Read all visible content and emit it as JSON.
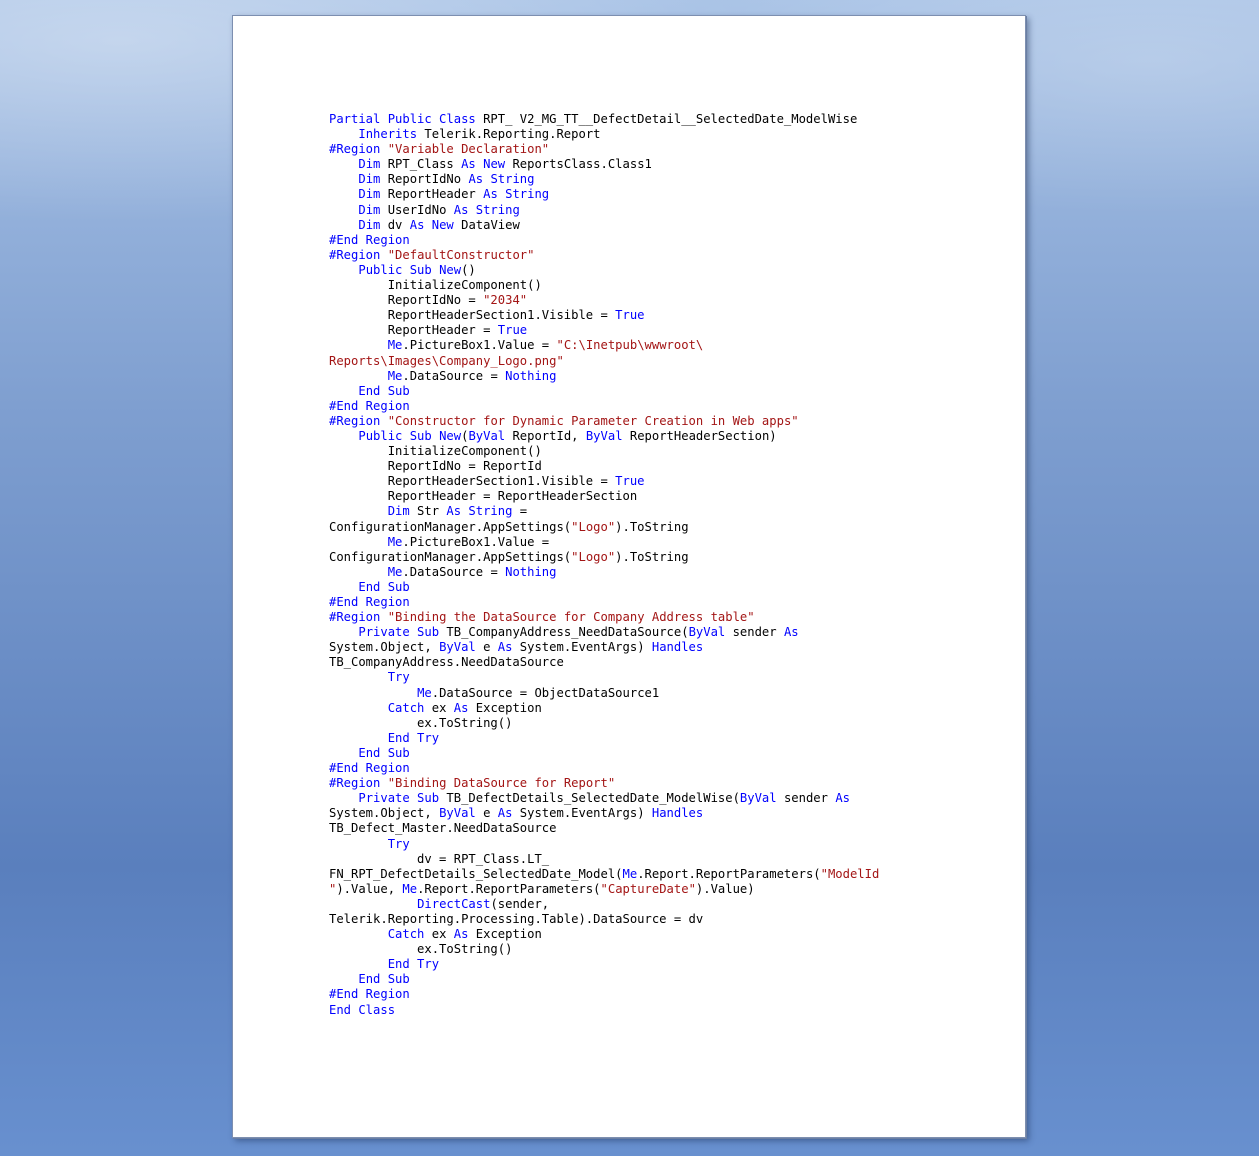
{
  "document": {
    "code_lines": [
      [
        {
          "k": "Partial Public Class"
        },
        {
          "t": " RPT_ V2_MG_TT__DefectDetail__SelectedDate_ModelWise"
        }
      ],
      [
        {
          "t": "    "
        },
        {
          "k": "Inherits"
        },
        {
          "t": " Telerik.Reporting.Report"
        }
      ],
      [
        {
          "k": "#Region"
        },
        {
          "t": " "
        },
        {
          "s": "\"Variable Declaration\""
        }
      ],
      [
        {
          "t": "    "
        },
        {
          "k": "Dim"
        },
        {
          "t": " RPT_Class "
        },
        {
          "k": "As New"
        },
        {
          "t": " ReportsClass.Class1"
        }
      ],
      [
        {
          "t": "    "
        },
        {
          "k": "Dim"
        },
        {
          "t": " ReportIdNo "
        },
        {
          "k": "As String"
        }
      ],
      [
        {
          "t": "    "
        },
        {
          "k": "Dim"
        },
        {
          "t": " ReportHeader "
        },
        {
          "k": "As String"
        }
      ],
      [
        {
          "t": "    "
        },
        {
          "k": "Dim"
        },
        {
          "t": " UserIdNo "
        },
        {
          "k": "As String"
        }
      ],
      [
        {
          "t": "    "
        },
        {
          "k": "Dim"
        },
        {
          "t": " dv "
        },
        {
          "k": "As New"
        },
        {
          "t": " DataView"
        }
      ],
      [
        {
          "k": "#End Region"
        }
      ],
      [
        {
          "k": "#Region"
        },
        {
          "t": " "
        },
        {
          "s": "\"DefaultConstructor\""
        }
      ],
      [
        {
          "t": "    "
        },
        {
          "k": "Public Sub New"
        },
        {
          "t": "()"
        }
      ],
      [
        {
          "t": "        InitializeComponent()"
        }
      ],
      [
        {
          "t": "        ReportIdNo = "
        },
        {
          "s": "\"2034\""
        }
      ],
      [
        {
          "t": "        ReportHeaderSection1.Visible = "
        },
        {
          "k": "True"
        }
      ],
      [
        {
          "t": "        ReportHeader = "
        },
        {
          "k": "True"
        }
      ],
      [
        {
          "t": "        "
        },
        {
          "k": "Me"
        },
        {
          "t": ".PictureBox1.Value = "
        },
        {
          "s": "\"C:\\Inetpub\\wwwroot\\"
        }
      ],
      [
        {
          "s": "Reports\\Images\\Company_Logo.png\""
        }
      ],
      [
        {
          "t": "        "
        },
        {
          "k": "Me"
        },
        {
          "t": ".DataSource = "
        },
        {
          "k": "Nothing"
        }
      ],
      [
        {
          "t": "    "
        },
        {
          "k": "End Sub"
        }
      ],
      [
        {
          "k": "#End Region"
        }
      ],
      [
        {
          "k": "#Region"
        },
        {
          "t": " "
        },
        {
          "s": "\"Constructor for Dynamic Parameter Creation in Web apps\""
        }
      ],
      [
        {
          "t": "    "
        },
        {
          "k": "Public Sub New"
        },
        {
          "t": "("
        },
        {
          "k": "ByVal"
        },
        {
          "t": " ReportId, "
        },
        {
          "k": "ByVal"
        },
        {
          "t": " ReportHeaderSection)"
        }
      ],
      [
        {
          "t": "        InitializeComponent()"
        }
      ],
      [
        {
          "t": "        ReportIdNo = ReportId"
        }
      ],
      [
        {
          "t": "        ReportHeaderSection1.Visible = "
        },
        {
          "k": "True"
        }
      ],
      [
        {
          "t": "        ReportHeader = ReportHeaderSection"
        }
      ],
      [
        {
          "t": "        "
        },
        {
          "k": "Dim"
        },
        {
          "t": " Str "
        },
        {
          "k": "As String"
        },
        {
          "t": " ="
        }
      ],
      [
        {
          "t": "ConfigurationManager.AppSettings("
        },
        {
          "s": "\"Logo\""
        },
        {
          "t": ").ToString"
        }
      ],
      [
        {
          "t": "        "
        },
        {
          "k": "Me"
        },
        {
          "t": ".PictureBox1.Value ="
        }
      ],
      [
        {
          "t": "ConfigurationManager.AppSettings("
        },
        {
          "s": "\"Logo\""
        },
        {
          "t": ").ToString"
        }
      ],
      [
        {
          "t": "        "
        },
        {
          "k": "Me"
        },
        {
          "t": ".DataSource = "
        },
        {
          "k": "Nothing"
        }
      ],
      [
        {
          "t": "    "
        },
        {
          "k": "End Sub"
        }
      ],
      [
        {
          "k": "#End Region"
        }
      ],
      [
        {
          "k": "#Region"
        },
        {
          "t": " "
        },
        {
          "s": "\"Binding the DataSource for Company Address table\""
        }
      ],
      [
        {
          "t": "    "
        },
        {
          "k": "Private Sub"
        },
        {
          "t": " TB_CompanyAddress_NeedDataSource("
        },
        {
          "k": "ByVal"
        },
        {
          "t": " sender "
        },
        {
          "k": "As"
        }
      ],
      [
        {
          "t": "System.Object, "
        },
        {
          "k": "ByVal"
        },
        {
          "t": " e "
        },
        {
          "k": "As"
        },
        {
          "t": " System.EventArgs) "
        },
        {
          "k": "Handles"
        }
      ],
      [
        {
          "t": "TB_CompanyAddress.NeedDataSource"
        }
      ],
      [
        {
          "t": "        "
        },
        {
          "k": "Try"
        }
      ],
      [
        {
          "t": "            "
        },
        {
          "k": "Me"
        },
        {
          "t": ".DataSource = ObjectDataSource1"
        }
      ],
      [
        {
          "t": "        "
        },
        {
          "k": "Catch"
        },
        {
          "t": " ex "
        },
        {
          "k": "As"
        },
        {
          "t": " Exception"
        }
      ],
      [
        {
          "t": "            ex.ToString()"
        }
      ],
      [
        {
          "t": "        "
        },
        {
          "k": "End Try"
        }
      ],
      [
        {
          "t": "    "
        },
        {
          "k": "End Sub"
        }
      ],
      [
        {
          "k": "#End Region"
        }
      ],
      [
        {
          "k": "#Region"
        },
        {
          "t": " "
        },
        {
          "s": "\"Binding DataSource for Report\""
        }
      ],
      [
        {
          "t": "    "
        },
        {
          "k": "Private Sub"
        },
        {
          "t": " TB_DefectDetails_SelectedDate_ModelWise("
        },
        {
          "k": "ByVal"
        },
        {
          "t": " sender "
        },
        {
          "k": "As"
        }
      ],
      [
        {
          "t": "System.Object, "
        },
        {
          "k": "ByVal"
        },
        {
          "t": " e "
        },
        {
          "k": "As"
        },
        {
          "t": " System.EventArgs) "
        },
        {
          "k": "Handles"
        }
      ],
      [
        {
          "t": "TB_Defect_Master.NeedDataSource"
        }
      ],
      [
        {
          "t": "        "
        },
        {
          "k": "Try"
        }
      ],
      [
        {
          "t": "            dv = RPT_Class.LT_"
        }
      ],
      [
        {
          "t": "FN_RPT_DefectDetails_SelectedDate_Model("
        },
        {
          "k": "Me"
        },
        {
          "t": ".Report.ReportParameters("
        },
        {
          "s": "\"ModelId"
        }
      ],
      [
        {
          "s": "\""
        },
        {
          "t": ").Value, "
        },
        {
          "k": "Me"
        },
        {
          "t": ".Report.ReportParameters("
        },
        {
          "s": "\"CaptureDate\""
        },
        {
          "t": ").Value)"
        }
      ],
      [
        {
          "t": "            "
        },
        {
          "k": "DirectCast"
        },
        {
          "t": "(sender,"
        }
      ],
      [
        {
          "t": "Telerik.Reporting.Processing.Table).DataSource = dv"
        }
      ],
      [
        {
          "t": "        "
        },
        {
          "k": "Catch"
        },
        {
          "t": " ex "
        },
        {
          "k": "As"
        },
        {
          "t": " Exception"
        }
      ],
      [
        {
          "t": "            ex.ToString()"
        }
      ],
      [
        {
          "t": "        "
        },
        {
          "k": "End Try"
        }
      ],
      [
        {
          "t": "    "
        },
        {
          "k": "End Sub"
        }
      ],
      [
        {
          "k": "#End Region"
        }
      ],
      [
        {
          "k": "End Class"
        }
      ]
    ]
  },
  "colors": {
    "keyword": "#0000ff",
    "string": "#a31515",
    "text": "#000000"
  }
}
